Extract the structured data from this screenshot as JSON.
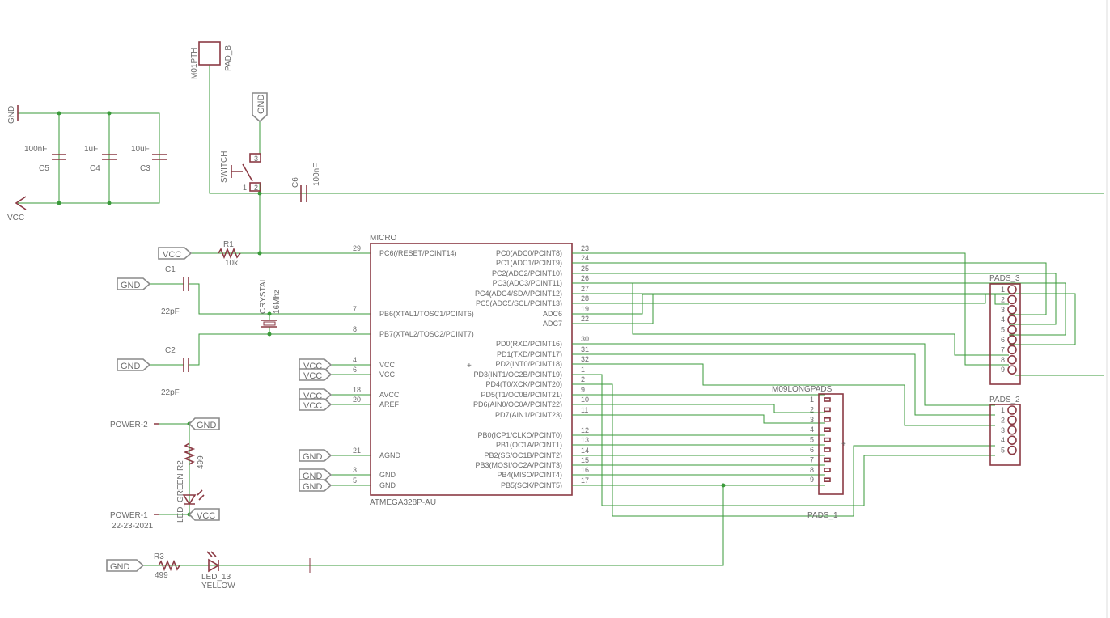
{
  "parts": {
    "c5": {
      "name": "C5",
      "value": "100nF"
    },
    "c4": {
      "name": "C4",
      "value": "1uF"
    },
    "c3": {
      "name": "C3",
      "value": "10uF"
    },
    "c6": {
      "name": "C6",
      "value": "100nF"
    },
    "c1": {
      "name": "C1",
      "value": "22pF"
    },
    "c2": {
      "name": "C2",
      "value": "22pF"
    },
    "r1": {
      "name": "R1",
      "value": "10k"
    },
    "r2": {
      "name": "R2",
      "value": "499"
    },
    "r3": {
      "name": "R3",
      "value": "499"
    },
    "pad_b": {
      "name": "PAD_B",
      "value": "M01PTH"
    },
    "switch": {
      "name": "SWITCH"
    },
    "crystal": {
      "name": "CRYSTAL",
      "value": "16Mhz"
    },
    "led_green": {
      "name": "LED_GREEN"
    },
    "led_13": {
      "name": "LED_13",
      "value": "YELLOW"
    },
    "micro": {
      "name": "MICRO",
      "value": "ATMEGA328P-AU"
    },
    "pads_3": {
      "name": "PADS_3"
    },
    "pads_2": {
      "name": "PADS_2"
    },
    "pads_1": {
      "name": "PADS_1",
      "value": "M09LONGPADS"
    }
  },
  "nets": {
    "gnd": "GND",
    "vcc": "VCC",
    "power1": "POWER-1",
    "power2": "POWER-2",
    "date": "22-23-2021"
  },
  "micro_left_pins": [
    {
      "num": "29",
      "name": "PC6(/RESET/PCINT14)"
    },
    {
      "num": "7",
      "name": "PB6(XTAL1/TOSC1/PCINT6)"
    },
    {
      "num": "8",
      "name": "PB7(XTAL2/TOSC2/PCINT7)"
    },
    {
      "num": "4",
      "name": "VCC"
    },
    {
      "num": "6",
      "name": "VCC"
    },
    {
      "num": "18",
      "name": "AVCC"
    },
    {
      "num": "20",
      "name": "AREF"
    },
    {
      "num": "21",
      "name": "AGND"
    },
    {
      "num": "3",
      "name": "GND"
    },
    {
      "num": "5",
      "name": "GND"
    }
  ],
  "micro_right_pins": [
    {
      "num": "23",
      "name": "PC0(ADC0/PCINT8)"
    },
    {
      "num": "24",
      "name": "PC1(ADC1/PCINT9)"
    },
    {
      "num": "25",
      "name": "PC2(ADC2/PCINT10)"
    },
    {
      "num": "26",
      "name": "PC3(ADC3/PCINT11)"
    },
    {
      "num": "27",
      "name": "PC4(ADC4/SDA/PCINT12)"
    },
    {
      "num": "28",
      "name": "PC5(ADC5/SCL/PCINT13)"
    },
    {
      "num": "19",
      "name": "ADC6"
    },
    {
      "num": "22",
      "name": "ADC7"
    },
    {
      "num": "30",
      "name": "PD0(RXD/PCINT16)"
    },
    {
      "num": "31",
      "name": "PD1(TXD/PCINT17)"
    },
    {
      "num": "32",
      "name": "PD2(INT0/PCINT18)"
    },
    {
      "num": "1",
      "name": "PD3(INT1/OC2B/PCINT19)"
    },
    {
      "num": "2",
      "name": "PD4(T0/XCK/PCINT20)"
    },
    {
      "num": "9",
      "name": "PD5(T1/OC0B/PCINT21)"
    },
    {
      "num": "10",
      "name": "PD6(AIN0/OC0A/PCINT22)"
    },
    {
      "num": "11",
      "name": "PD7(AIN1/PCINT23)"
    },
    {
      "num": "12",
      "name": "PB0(ICP1/CLKO/PCINT0)"
    },
    {
      "num": "13",
      "name": "PB1(OC1A/PCINT1)"
    },
    {
      "num": "14",
      "name": "PB2(SS/OC1B/PCINT2)"
    },
    {
      "num": "15",
      "name": "PB3(MOSI/OC2A/PCINT3)"
    },
    {
      "num": "16",
      "name": "PB4(MISO/PCINT4)"
    },
    {
      "num": "17",
      "name": "PB5(SCK/PCINT5)"
    }
  ],
  "pads_3_pins": [
    "1",
    "2",
    "3",
    "4",
    "5",
    "6",
    "7",
    "8",
    "9"
  ],
  "pads_2_pins": [
    "1",
    "2",
    "3",
    "4",
    "5"
  ],
  "pads_1_pins": [
    "1",
    "2",
    "3",
    "4",
    "5",
    "6",
    "7",
    "8",
    "9"
  ],
  "switch_pins": [
    "1",
    "2",
    "3"
  ],
  "colors": {
    "wire": "#3a9a3a",
    "symbol": "#8b3a44",
    "text": "#6b6b6b",
    "net_tag": "#8a8a8a"
  }
}
